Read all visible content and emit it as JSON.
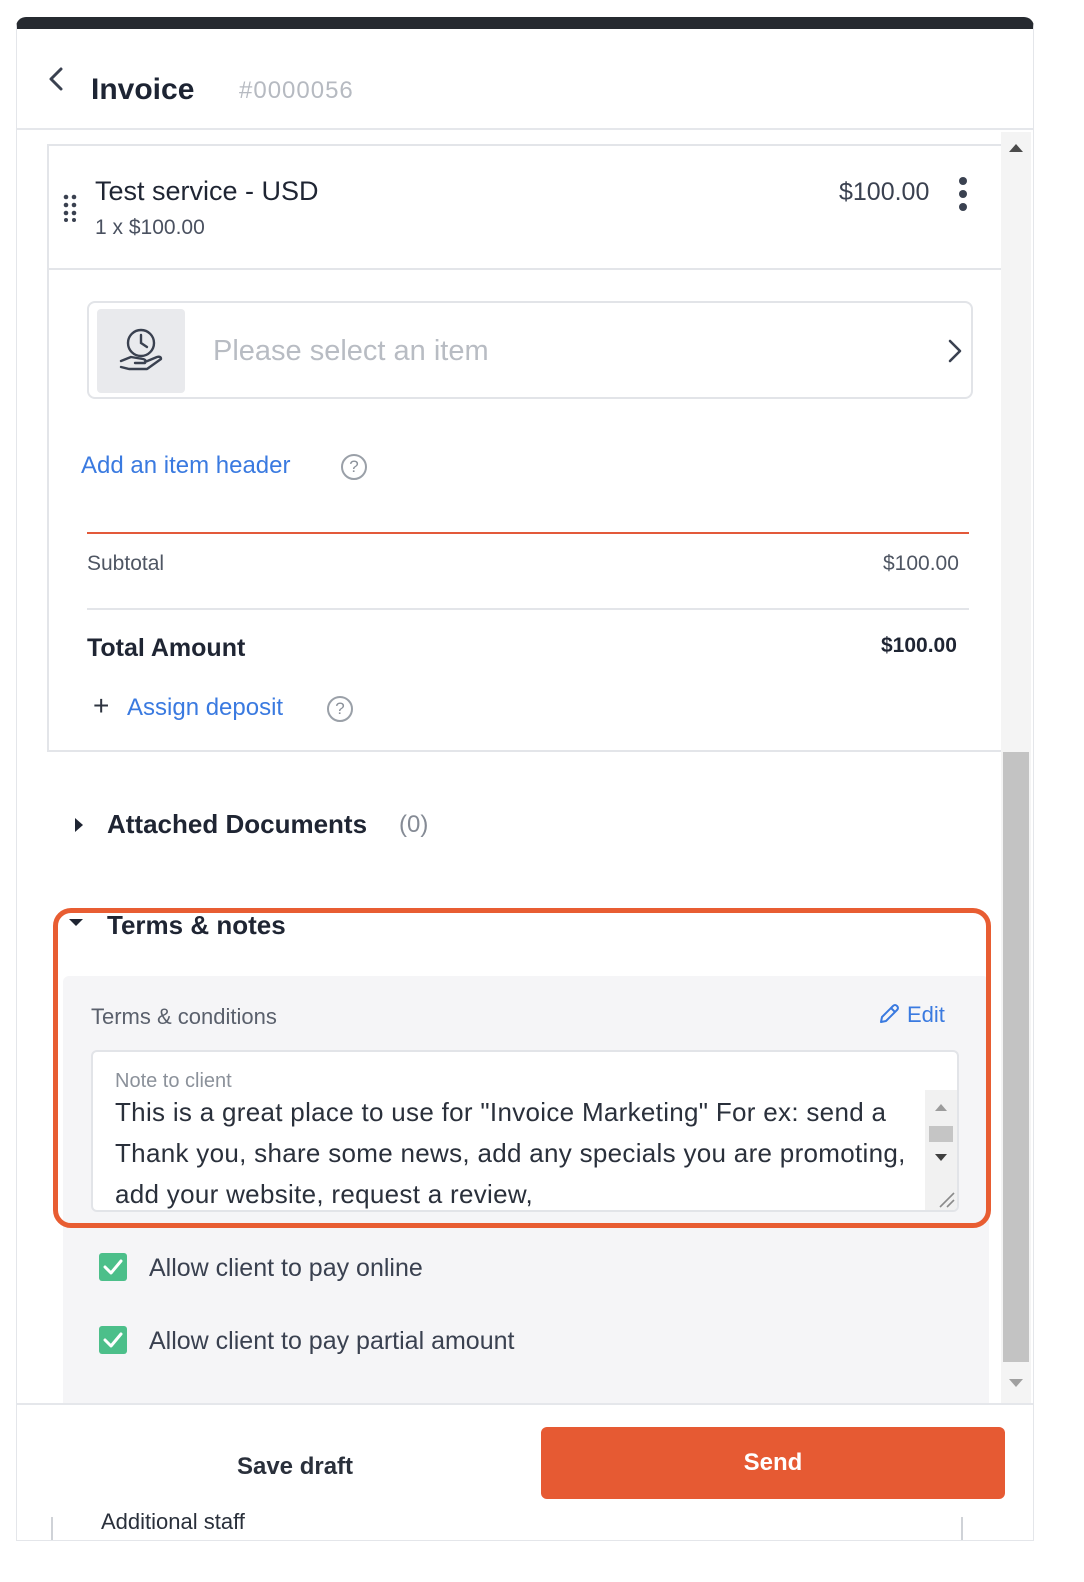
{
  "header": {
    "title": "Invoice",
    "invoice_number": "#0000056"
  },
  "line_item": {
    "name": "Test service - USD",
    "quantity_price": "1 x $100.00",
    "amount": "$100.00"
  },
  "item_selector": {
    "placeholder": "Please select an item"
  },
  "add_item_header": "Add an item header",
  "help_glyph": "?",
  "totals": {
    "subtotal_label": "Subtotal",
    "subtotal_value": "$100.00",
    "total_label": "Total Amount",
    "total_value": "$100.00"
  },
  "assign_deposit": {
    "plus": "+",
    "label": "Assign deposit"
  },
  "attached_documents": {
    "label": "Attached Documents",
    "count": "(0)"
  },
  "terms": {
    "title": "Terms & notes",
    "conditions_label": "Terms & conditions",
    "edit_label": "Edit",
    "note_label": "Note to client",
    "note_text": "This is a great place to use for \"Invoice Marketing\" For ex: send a Thank you, share some news, add any specials you are promoting, add your website, request a review,"
  },
  "options": [
    {
      "label": "Allow client to pay online",
      "checked": true
    },
    {
      "label": "Allow client to pay partial amount",
      "checked": true
    }
  ],
  "footer": {
    "save_draft": "Save draft",
    "send": "Send",
    "peek_text": "Additional staff"
  },
  "colors": {
    "accent": "#e65a33",
    "link": "#3a7ae0",
    "checkbox": "#4cbf8a"
  },
  "icons": [
    "chevron-left-icon",
    "drag-handle-icon",
    "kebab-menu-icon",
    "service-hand-icon",
    "chevron-right-icon",
    "help-icon",
    "plus-icon",
    "caret-right-icon",
    "caret-down-icon",
    "pencil-icon",
    "checkmark-icon",
    "resize-icon"
  ]
}
